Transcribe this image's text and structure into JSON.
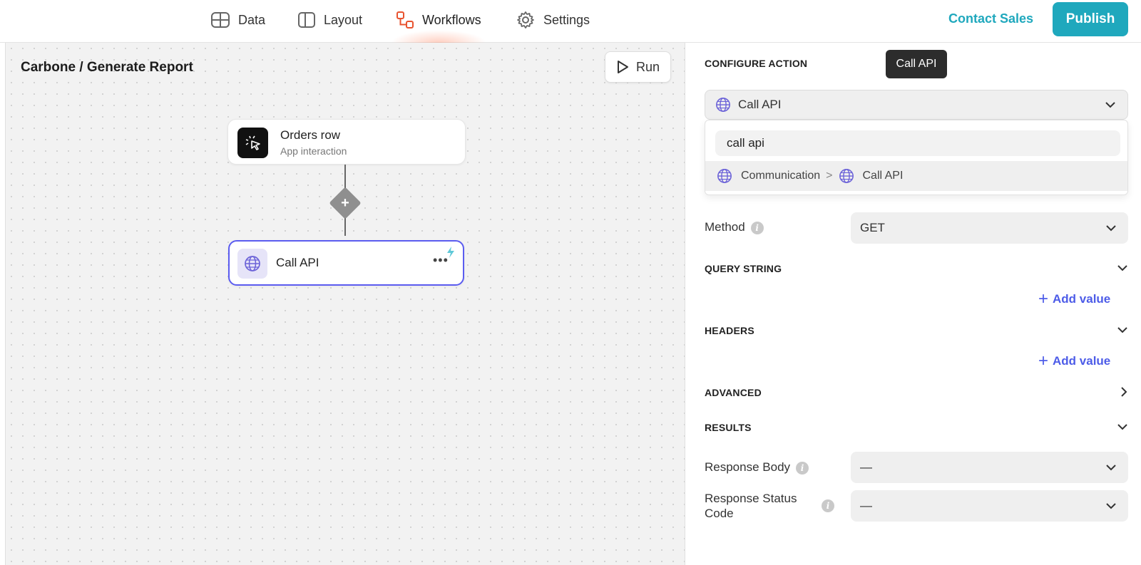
{
  "nav": {
    "items": [
      {
        "label": "Data",
        "icon": "table-icon"
      },
      {
        "label": "Layout",
        "icon": "layout-icon"
      },
      {
        "label": "Workflows",
        "icon": "workflow-icon",
        "active": true
      },
      {
        "label": "Settings",
        "icon": "gear-icon"
      }
    ],
    "contact_sales": "Contact Sales",
    "publish": "Publish"
  },
  "canvas": {
    "title": "Carbone / Generate Report",
    "run_label": "Run",
    "trigger_node": {
      "title": "Orders row",
      "subtitle": "App interaction"
    },
    "action_node": {
      "title": "Call API",
      "more": "•••"
    },
    "add_step": "+"
  },
  "panel": {
    "configure_action_label": "CONFIGURE ACTION",
    "tooltip": "Call API",
    "selected_action": "Call API",
    "search_value": "call api",
    "search_result": {
      "category": "Communication",
      "separator": ">",
      "action": "Call API"
    },
    "method_label": "Method",
    "method_value": "GET",
    "query_string_label": "QUERY STRING",
    "headers_label": "HEADERS",
    "add_value": "Add value",
    "advanced_label": "ADVANCED",
    "results_label": "RESULTS",
    "response_body_label": "Response Body",
    "response_body_value": "—",
    "response_status_label_1": "Response Status",
    "response_status_label_2": "Code",
    "response_status_value": "—",
    "info": "i"
  },
  "colors": {
    "accent": "#1fa8bd",
    "selected_border": "#5b5cf0",
    "link": "#4d5ce8",
    "workflow_icon": "#e8532f"
  }
}
